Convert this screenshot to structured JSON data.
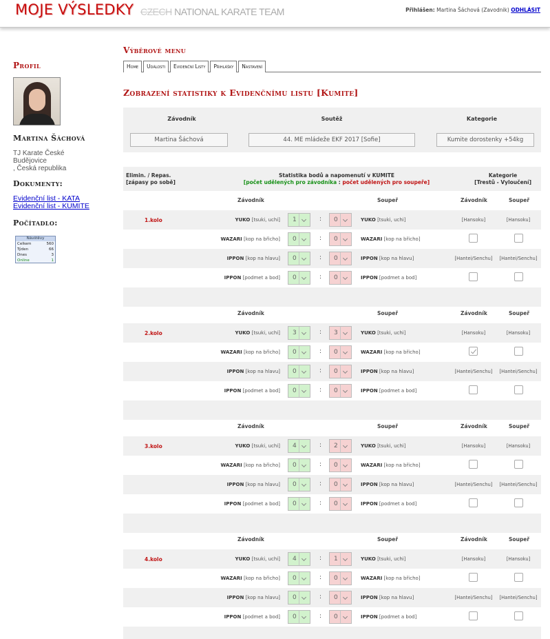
{
  "header": {
    "logo_main": "MOJE VÝSLEDKY",
    "logo_sub_strike": "CZECH",
    "logo_sub_rest": " NATIONAL KARATE TEAM",
    "login_label": "Přihlášen:",
    "login_user": "Martina Šáchová (Zavodnik)",
    "logout_label": "ODHLÁSIT"
  },
  "sidebar": {
    "profile_title": "Profil",
    "athlete_name": "Martina Šáchová",
    "club_lines": [
      "TJ Karate České",
      "Budějovice",
      ", Česká republika"
    ],
    "documents_title": "Dokumenty:",
    "documents": [
      "Evidenční list - KATA",
      "Evidenční list - KUMITE"
    ],
    "counter_title": "Počítadlo:",
    "counter": {
      "title": "Návštěvy",
      "rows": [
        {
          "label": "Celkem",
          "value": "560"
        },
        {
          "label": "Týden",
          "value": "66"
        },
        {
          "label": "Dnes",
          "value": "3"
        },
        {
          "label": "Online",
          "value": "1"
        }
      ]
    }
  },
  "main": {
    "menu_title": "Výběrové menu",
    "tabs": [
      "Home",
      "Události",
      "Evidenční Listy",
      "Přihlášky",
      "Nastavení"
    ],
    "page_title": "Zobrazení statistiky k Evidenčnímu listu [Kumite]",
    "info": {
      "headers": {
        "athlete": "Závodník",
        "competition": "Soutěž",
        "category": "Kategorie"
      },
      "values": {
        "athlete": "Martina Šáchová",
        "competition": "44. ME mládeže EKF 2017 [Sofie]",
        "category": "Kumite dorostenky +54kg"
      }
    },
    "stat_head": {
      "col1_line1": "Elimin. / Repas.",
      "col1_line2": "[zápasy po sobě]",
      "col2_line1": "Statistika bodů a napomenutí v KUMITE",
      "col2_open": "[",
      "col2_green": "počet udělených pro závodníka",
      "col2_sep": " : ",
      "col2_red": "počet udělených pro soupeře",
      "col2_close": "]",
      "col3_line1": "Kategorie",
      "col3_line2": "[Trestů - Vyloučení]"
    },
    "column_labels": {
      "athlete": "Závodník",
      "opponent": "Soupeř",
      "pen_athlete": "Závodník",
      "pen_opponent": "Soupeř"
    },
    "score_labels": [
      {
        "name": "YUKO",
        "note": "[tsuki, uchi]"
      },
      {
        "name": "WAZARI",
        "note": "[kop na břicho]"
      },
      {
        "name": "IPPON",
        "note": "[kop na hlavu]"
      },
      {
        "name": "IPPON",
        "note": "[podmet a bod]"
      }
    ],
    "penalty_labels": [
      "[Hansoku]",
      "[Hantei/Senchu]"
    ],
    "colon": ":",
    "rounds": [
      {
        "label": "1.kolo",
        "scores": [
          [
            "1",
            "0"
          ],
          [
            "0",
            "0"
          ],
          [
            "0",
            "0"
          ],
          [
            "0",
            "0"
          ]
        ],
        "checks": [
          false,
          false
        ]
      },
      {
        "label": "2.kolo",
        "scores": [
          [
            "3",
            "3"
          ],
          [
            "0",
            "0"
          ],
          [
            "0",
            "0"
          ],
          [
            "0",
            "0"
          ]
        ],
        "checks": [
          true,
          false
        ]
      },
      {
        "label": "3.kolo",
        "scores": [
          [
            "4",
            "2"
          ],
          [
            "0",
            "0"
          ],
          [
            "0",
            "0"
          ],
          [
            "0",
            "0"
          ]
        ],
        "checks": [
          false,
          false
        ]
      },
      {
        "label": "4.kolo",
        "scores": [
          [
            "4",
            "1"
          ],
          [
            "0",
            "0"
          ],
          [
            "0",
            "0"
          ],
          [
            "0",
            "0"
          ]
        ],
        "checks": [
          false,
          false
        ]
      }
    ]
  }
}
